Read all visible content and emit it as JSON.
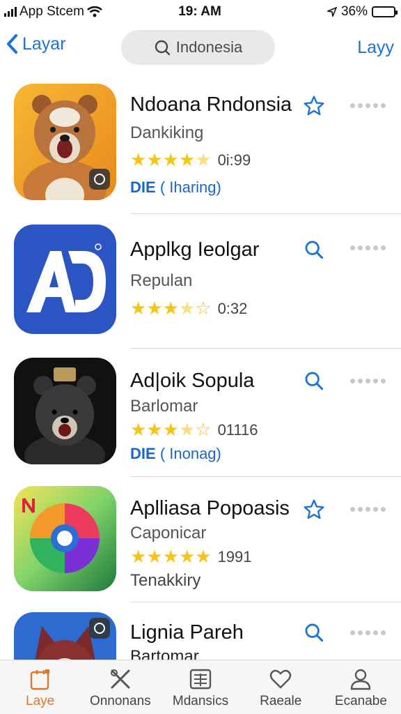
{
  "status": {
    "carrier": "App Stcem",
    "time": "19: AM",
    "battery": "36%",
    "battery_level": 0.36
  },
  "nav": {
    "back_label": "Layar",
    "search_text": "Indonesia",
    "right_label": "Layy"
  },
  "apps": [
    {
      "name": "Ndoana Rndonsia",
      "sub": "Dankiking",
      "rating": 4.5,
      "count": "0i:99",
      "tag_bold": "DIE",
      "tag_rest": "( Iharing)",
      "action": "star-outline-icon",
      "icon": "bear-app-icon"
    },
    {
      "name": "Applkg Ieolgar",
      "sub": "Repulan",
      "rating": 3.5,
      "count": "0:32",
      "tag_bold": "",
      "tag_rest": "",
      "action": "search-icon",
      "icon": "ad-app-icon"
    },
    {
      "name": "Ad|oik Sopula",
      "sub": "Barlomar",
      "rating": 3.5,
      "count": "01116",
      "tag_bold": "DIE",
      "tag_rest": "( Inonag)",
      "action": "search-icon",
      "icon": "black-bear-app-icon"
    },
    {
      "name": "Aplliasa Popoasis",
      "sub": "Caponicar",
      "rating": 5,
      "count": "1991",
      "tag_bold": "",
      "tag_rest": "Tenakkiry",
      "action": "star-outline-icon",
      "icon": "colorful-app-icon"
    },
    {
      "name": "Lignia Pareh",
      "sub": "Bartomar",
      "rating": 0,
      "count": "",
      "tag_bold": "",
      "tag_rest": "",
      "action": "search-icon",
      "icon": "wolf-app-icon"
    }
  ],
  "tabs": [
    {
      "label": "Laye",
      "icon": "today-icon",
      "active": true
    },
    {
      "label": "Onnonans",
      "icon": "tools-icon",
      "active": false
    },
    {
      "label": "Mdansics",
      "icon": "grid-icon",
      "active": false
    },
    {
      "label": "Raeale",
      "icon": "heart-icon",
      "active": false
    },
    {
      "label": "Ecanabe",
      "icon": "person-icon",
      "active": false
    }
  ],
  "colors": {
    "accent": "#1a73d9",
    "star": "#f5c518",
    "tab_active": "#e0762b",
    "tag": "#1a66c9"
  }
}
